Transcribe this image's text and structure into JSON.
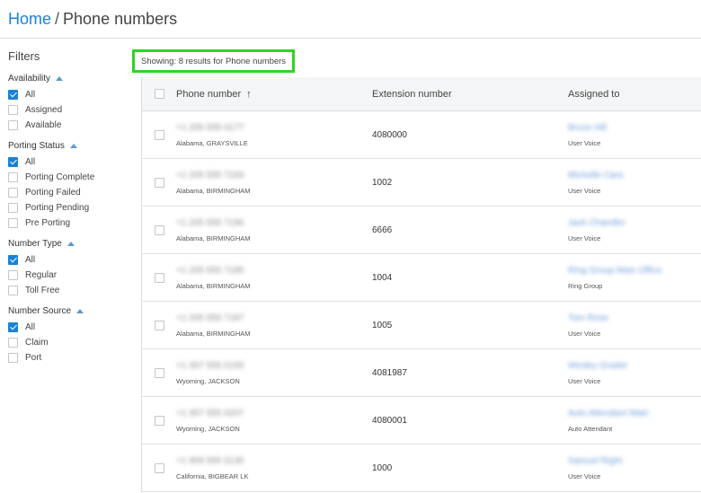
{
  "breadcrumb": {
    "home": "Home",
    "separator": "/",
    "current": "Phone numbers"
  },
  "sidebar": {
    "title": "Filters",
    "groups": [
      {
        "label": "Availability",
        "options": [
          {
            "label": "All",
            "checked": true
          },
          {
            "label": "Assigned",
            "checked": false
          },
          {
            "label": "Available",
            "checked": false
          }
        ]
      },
      {
        "label": "Porting Status",
        "options": [
          {
            "label": "All",
            "checked": true
          },
          {
            "label": "Porting Complete",
            "checked": false
          },
          {
            "label": "Porting Failed",
            "checked": false
          },
          {
            "label": "Porting Pending",
            "checked": false
          },
          {
            "label": "Pre Porting",
            "checked": false
          }
        ]
      },
      {
        "label": "Number Type",
        "options": [
          {
            "label": "All",
            "checked": true
          },
          {
            "label": "Regular",
            "checked": false
          },
          {
            "label": "Toll Free",
            "checked": false
          }
        ]
      },
      {
        "label": "Number Source",
        "options": [
          {
            "label": "All",
            "checked": true
          },
          {
            "label": "Claim",
            "checked": false
          },
          {
            "label": "Port",
            "checked": false
          }
        ]
      }
    ]
  },
  "results": {
    "showing": "Showing: 8 results for Phone numbers"
  },
  "table": {
    "columns": {
      "phone": "Phone number",
      "sort_icon": "arrow-up-icon",
      "extension": "Extension number",
      "assigned": "Assigned to"
    },
    "rows": [
      {
        "phone": "+1 205 555 0177",
        "location": "Alabama, GRAYSVILLE",
        "extension": "4080000",
        "assignee": "Bruce Hill",
        "assignee_type": "User Voice"
      },
      {
        "phone": "+1 205 555 7183",
        "location": "Alabama, BIRMINGHAM",
        "extension": "1002",
        "assignee": "Michelle Cara",
        "assignee_type": "User Voice"
      },
      {
        "phone": "+1 205 555 7190",
        "location": "Alabama, BIRMINGHAM",
        "extension": "6666",
        "assignee": "Jack Chandler",
        "assignee_type": "User Voice"
      },
      {
        "phone": "+1 205 555 7185",
        "location": "Alabama, BIRMINGHAM",
        "extension": "1004",
        "assignee": "Ring Group Main Office",
        "assignee_type": "Ring Group"
      },
      {
        "phone": "+1 205 555 7187",
        "location": "Alabama, BIRMINGHAM",
        "extension": "1005",
        "assignee": "Tom Rose",
        "assignee_type": "User Voice"
      },
      {
        "phone": "+1 307 555 0193",
        "location": "Wyoming, JACKSON",
        "extension": "4081987",
        "assignee": "Wesley Grader",
        "assignee_type": "User Voice"
      },
      {
        "phone": "+1 307 555 0207",
        "location": "Wyoming, JACKSON",
        "extension": "4080001",
        "assignee": "Auto Attendant Main",
        "assignee_type": "Auto Attendant"
      },
      {
        "phone": "+1 909 555 0135",
        "location": "California, BIGBEAR LK",
        "extension": "1000",
        "assignee": "Samuel Right",
        "assignee_type": "User Voice"
      }
    ]
  }
}
